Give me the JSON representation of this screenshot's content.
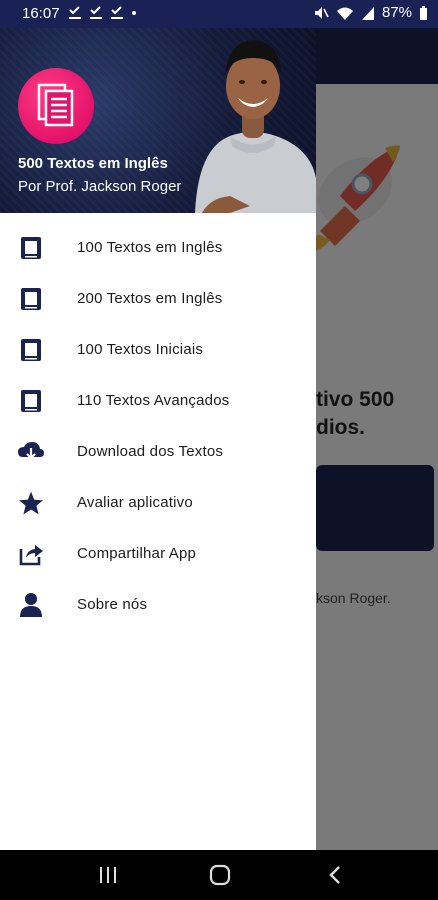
{
  "status_bar": {
    "time": "16:07",
    "battery": "87%",
    "notification_icons": [
      "check-download-icon",
      "check-download-icon",
      "check-download-icon",
      "dot-icon"
    ],
    "system_icons": [
      "mute-icon",
      "wifi-icon",
      "signal-icon",
      "battery-icon"
    ]
  },
  "background_app": {
    "visible_text_line1": "tivo 500",
    "visible_text_line2": "dios.",
    "author_fragment": "kson Roger."
  },
  "drawer": {
    "header": {
      "title": "500 Textos em Inglês",
      "subtitle": "Por Prof. Jackson Roger",
      "logo_icon": "document-icon",
      "logo_color": "#e3126a",
      "background_color": "#141b3a"
    },
    "items": [
      {
        "label": "100 Textos em Inglês",
        "icon": "book-icon"
      },
      {
        "label": "200 Textos em Inglês",
        "icon": "book-icon"
      },
      {
        "label": "100 Textos Iniciais",
        "icon": "book-icon"
      },
      {
        "label": "110 Textos Avançados",
        "icon": "book-icon"
      },
      {
        "label": "Download dos Textos",
        "icon": "cloud-download-icon"
      },
      {
        "label": "Avaliar aplicativo",
        "icon": "star-icon"
      },
      {
        "label": "Compartilhar App",
        "icon": "share-icon"
      },
      {
        "label": "Sobre nós",
        "icon": "person-icon"
      }
    ],
    "icon_color": "#1a2452"
  },
  "nav_bar": {
    "buttons": [
      "recents-icon",
      "home-icon",
      "back-icon"
    ]
  }
}
